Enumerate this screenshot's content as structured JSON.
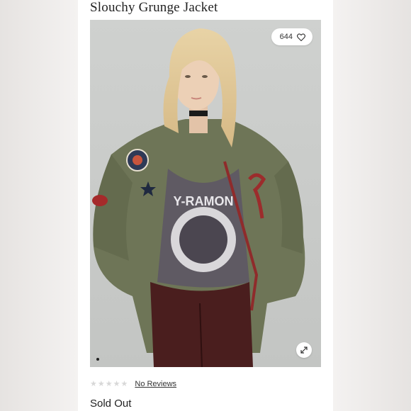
{
  "product": {
    "title": "Slouchy Grunge Jacket",
    "likes": "644",
    "status": "Sold Out"
  },
  "reviews": {
    "link_label": "No Reviews",
    "rating": 0,
    "max_rating": 5
  },
  "gallery": {
    "image_text": "Y-RAMON"
  },
  "icons": {
    "like": "heart-icon",
    "expand": "expand-icon",
    "star": "star-icon"
  },
  "colors": {
    "star_empty": "#d8d8d8",
    "jacket": "#6e7557",
    "pants": "#4a1e1e"
  }
}
